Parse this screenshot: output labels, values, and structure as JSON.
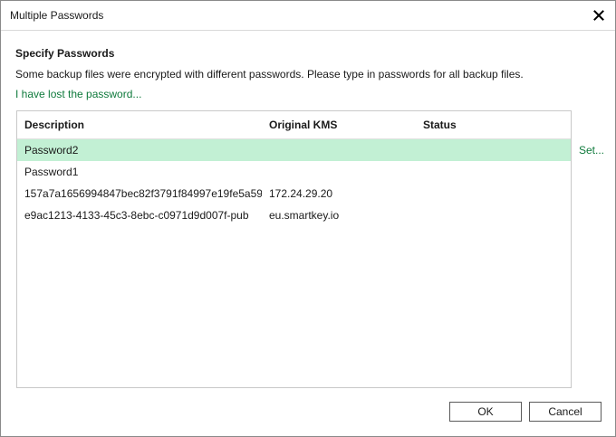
{
  "window": {
    "title": "Multiple Passwords"
  },
  "header": {
    "heading": "Specify Passwords",
    "description": "Some backup files were encrypted with different passwords. Please type in passwords for all backup files.",
    "lost_password_link": "I have lost the password..."
  },
  "table": {
    "columns": [
      "Description",
      "Original KMS",
      "Status"
    ],
    "rows": [
      {
        "description": "Password2",
        "kms": "",
        "status": "",
        "selected": true
      },
      {
        "description": "Password1",
        "kms": "",
        "status": "",
        "selected": false
      },
      {
        "description": "157a7a1656994847bec82f3791f84997e19fe5a59...",
        "kms": "172.24.29.20",
        "status": "",
        "selected": false
      },
      {
        "description": "e9ac1213-4133-45c3-8ebc-c0971d9d007f-pub",
        "kms": "eu.smartkey.io",
        "status": "",
        "selected": false
      }
    ]
  },
  "set_link": "Set...",
  "buttons": {
    "ok": "OK",
    "cancel": "Cancel"
  },
  "colors": {
    "accent_link": "#0f7a3c",
    "selected_row": "#c2f0d4"
  },
  "icons": {
    "close": "close-icon"
  }
}
